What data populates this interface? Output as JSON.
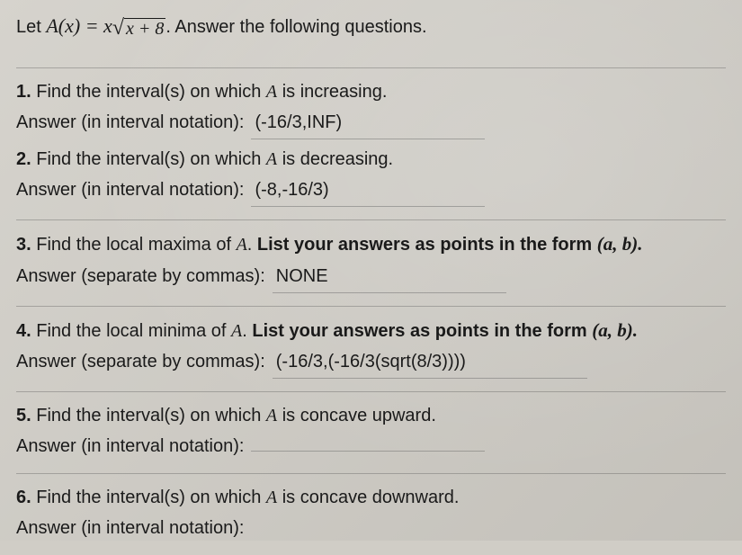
{
  "intro": {
    "prefix": "Let ",
    "func_lhs": "A(x) = x",
    "sqrt_inner": "x + 8",
    "suffix": ". Answer the following questions."
  },
  "questions": [
    {
      "num": "1.",
      "text_before": " Find the interval(s) on which ",
      "var": "A",
      "text_after": " is increasing.",
      "ans_label": "Answer (in interval notation): ",
      "ans_value": "(-16/3,INF)",
      "bold_span": "",
      "form": ""
    },
    {
      "num": "2.",
      "text_before": " Find the interval(s) on which ",
      "var": "A",
      "text_after": " is decreasing.",
      "ans_label": "Answer (in interval notation): ",
      "ans_value": "(-8,-16/3)",
      "bold_span": "",
      "form": ""
    },
    {
      "num": "3.",
      "text_before": " Find the local maxima of ",
      "var": "A",
      "text_after": ". ",
      "bold_span": "List your answers as points in the form ",
      "form": "(a, b).",
      "ans_label": "Answer (separate by commas): ",
      "ans_value": "NONE"
    },
    {
      "num": "4.",
      "text_before": " Find the local minima of ",
      "var": "A",
      "text_after": ". ",
      "bold_span": "List your answers as points in the form ",
      "form": "(a, b).",
      "ans_label": "Answer (separate by commas): ",
      "ans_value": "(-16/3,(-16/3(sqrt(8/3))))"
    },
    {
      "num": "5.",
      "text_before": " Find the interval(s) on which ",
      "var": "A",
      "text_after": " is concave upward.",
      "bold_span": "",
      "form": "",
      "ans_label": "Answer (in interval notation): ",
      "ans_value": ""
    },
    {
      "num": "6.",
      "text_before": " Find the interval(s) on which ",
      "var": "A",
      "text_after": " is concave downward.",
      "bold_span": "",
      "form": "",
      "ans_label": "Answer (in interval notation): ",
      "ans_value": ""
    }
  ]
}
